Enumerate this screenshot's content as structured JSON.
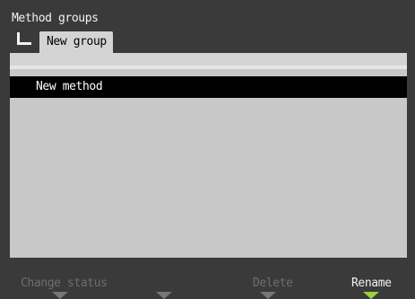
{
  "header": {
    "title": "Method groups"
  },
  "tabs": [
    {
      "label": "New group"
    }
  ],
  "list": {
    "items": [
      {
        "label": "New method"
      }
    ]
  },
  "softkeys": [
    {
      "label": "Change status",
      "enabled": false
    },
    {
      "label": "",
      "enabled": false
    },
    {
      "label": "Delete",
      "enabled": false
    },
    {
      "label": "Rename",
      "enabled": true
    }
  ],
  "colors": {
    "accent": "#9ad13b",
    "background": "#3a3a3a",
    "panel": "#c8c8c8",
    "selection": "#000000"
  }
}
